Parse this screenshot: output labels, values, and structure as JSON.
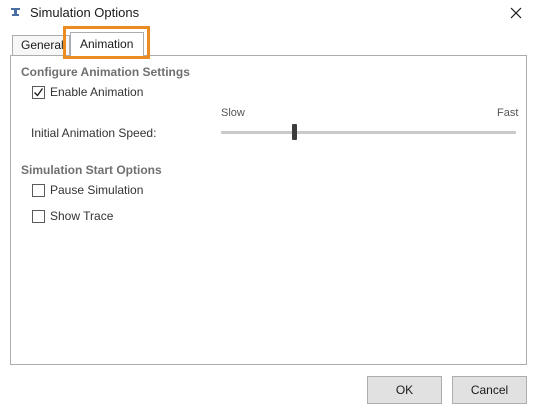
{
  "window": {
    "title": "Simulation Options",
    "app_icon": "app-icon",
    "close_icon": "close-icon"
  },
  "tabs": [
    {
      "label": "General",
      "selected": false
    },
    {
      "label": "Animation",
      "selected": true
    }
  ],
  "highlight_color": "#ed8b23",
  "animation_settings": {
    "heading": "Configure Animation Settings",
    "enable_animation": {
      "label": "Enable Animation",
      "checked": true
    },
    "speed_label": "Initial Animation Speed:",
    "speed_min_label": "Slow",
    "speed_max_label": "Fast",
    "speed_value_fraction": 0.25
  },
  "start_options": {
    "heading": "Simulation Start Options",
    "pause_simulation": {
      "label": "Pause Simulation",
      "checked": false
    },
    "show_trace": {
      "label": "Show Trace",
      "checked": false
    }
  },
  "buttons": {
    "ok_label": "OK",
    "cancel_label": "Cancel"
  }
}
